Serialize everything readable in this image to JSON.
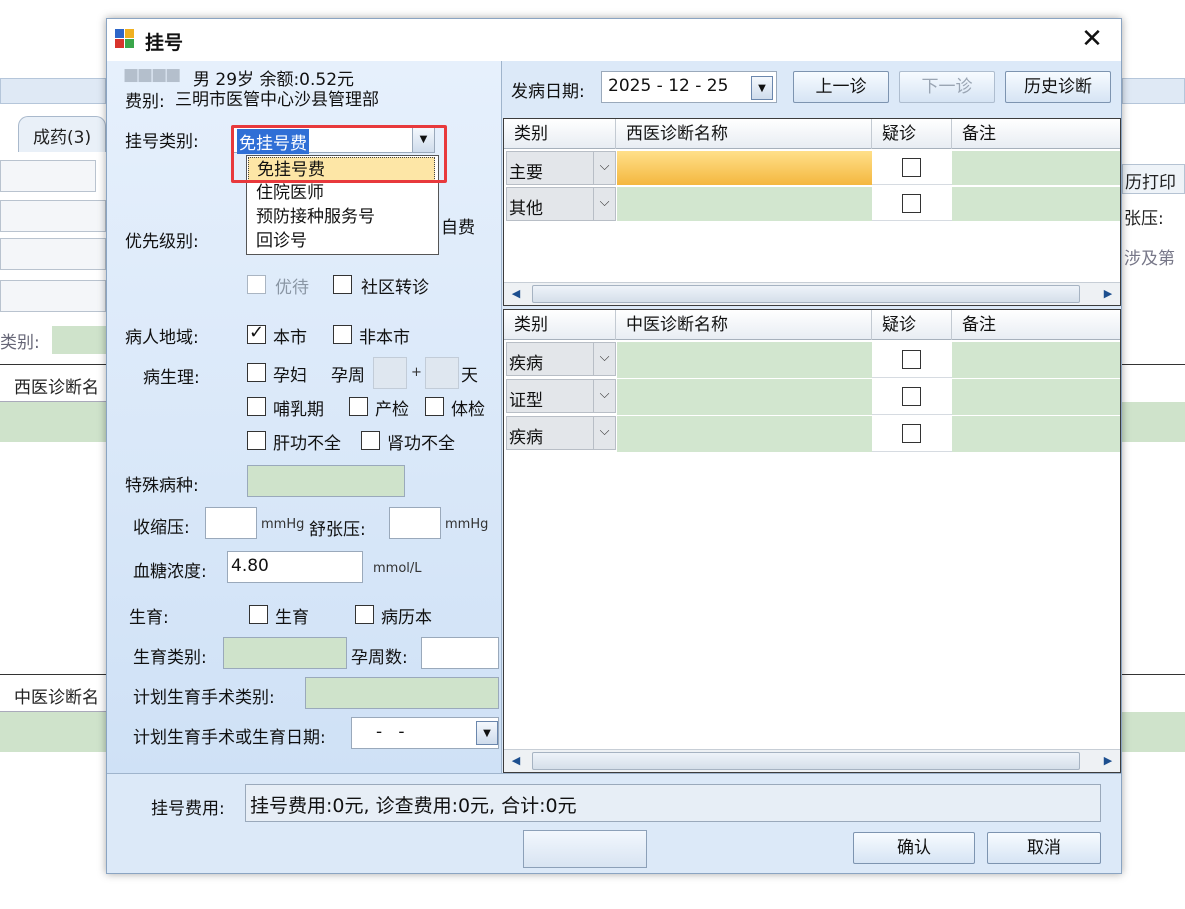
{
  "background_app": {
    "tab_label": "成药(3)",
    "category_label": "类别:",
    "western_diag_header": "西医诊断名",
    "chinese_diag_header": "中医诊断名",
    "right_print": "历打印",
    "right_bp": "张压:",
    "right_involve": "涉及第"
  },
  "dialog": {
    "title": "挂号",
    "close_label": "✕",
    "patient": {
      "name_masked": "■■■■",
      "summary": "男 29岁 余额:0.52元",
      "fee_type_label": "费别:",
      "fee_type_value": "三明市医管中心沙县管理部"
    },
    "reg_type": {
      "label": "挂号类别:",
      "value": "免挂号费",
      "options": [
        "免挂号费",
        "住院医师",
        "预防接种服务号",
        "回诊号"
      ],
      "selected_index": 0,
      "self_pay_label": "自费"
    },
    "priority": {
      "label": "优先级别:",
      "preferential_label": "优待",
      "community_referral_label": "社区转诊"
    },
    "region": {
      "label": "病人地域:",
      "local_label": "本市",
      "local_checked": true,
      "nonlocal_label": "非本市",
      "nonlocal_checked": false
    },
    "physiology": {
      "label": "病生理:",
      "pregnant_label": "孕妇",
      "gest_week_label": "孕周",
      "plus": "+",
      "day_label": "天",
      "lactation_label": "哺乳期",
      "prenatal_label": "产检",
      "checkup_label": "体检",
      "liver_label": "肝功不全",
      "kidney_label": "肾功不全"
    },
    "special_disease_label": "特殊病种:",
    "bp": {
      "systolic_label": "收缩压:",
      "diastolic_label": "舒张压:",
      "unit": "mmHg"
    },
    "glucose": {
      "label": "血糖浓度:",
      "value": "4.80",
      "unit": "mmol/L"
    },
    "fertility": {
      "label": "生育:",
      "fertility_cb_label": "生育",
      "record_cb_label": "病历本",
      "type_label": "生育类别:",
      "gest_weeks_label": "孕周数:",
      "surgery_type_label": "计划生育手术类别:",
      "surgery_date_label": "计划生育手术或生育日期:",
      "surgery_date_value": "-   -"
    },
    "onset": {
      "label": "发病日期:",
      "value": "2025 - 12 - 25"
    },
    "nav_buttons": {
      "prev": "上一诊",
      "next": "下一诊",
      "history": "历史诊断"
    },
    "western_grid": {
      "headers": [
        "类别",
        "西医诊断名称",
        "疑诊",
        "备注"
      ],
      "rows": [
        {
          "category": "主要"
        },
        {
          "category": "其他"
        }
      ]
    },
    "chinese_grid": {
      "headers": [
        "类别",
        "中医诊断名称",
        "疑诊",
        "备注"
      ],
      "rows": [
        {
          "category": "疾病"
        },
        {
          "category": "证型"
        },
        {
          "category": "疾病"
        }
      ]
    },
    "fee": {
      "label": "挂号费用:",
      "value": "挂号费用:0元, 诊查费用:0元, 合计:0元"
    },
    "footer": {
      "confirm": "确认",
      "cancel": "取消"
    }
  }
}
